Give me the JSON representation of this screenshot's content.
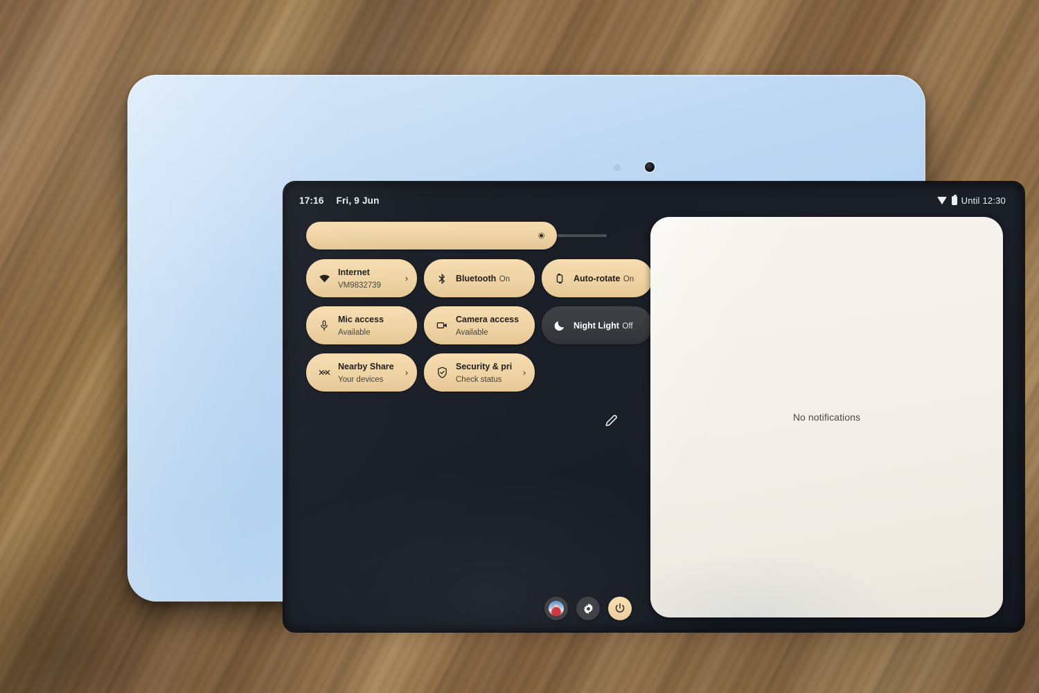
{
  "device": {
    "label": "tablet",
    "bezel_color": "#bcd7f2",
    "screen_bg": "#171b23"
  },
  "statusbar": {
    "time": "17:16",
    "date": "Fri, 9 Jun",
    "wifi_icon": "wifi-icon",
    "battery_icon": "battery-icon",
    "battery_text": "Until 12:30"
  },
  "quick_settings": {
    "brightness": {
      "label": "Brightness",
      "icon": "brightness-icon",
      "value_percent": 84
    },
    "tiles": [
      {
        "title": "Internet",
        "subtitle": "VM9832739",
        "icon": "wifi-icon",
        "state": "active",
        "has_chevron": true
      },
      {
        "title": "Bluetooth",
        "subtitle": "On",
        "icon": "bluetooth-icon",
        "state": "active",
        "has_chevron": false
      },
      {
        "title": "Auto-rotate",
        "subtitle": "On",
        "icon": "auto-rotate-icon",
        "state": "active",
        "has_chevron": false
      },
      {
        "title": "Mic access",
        "subtitle": "Available",
        "icon": "microphone-icon",
        "state": "active",
        "has_chevron": false
      },
      {
        "title": "Camera access",
        "subtitle": "Available",
        "icon": "camera-icon",
        "state": "active",
        "has_chevron": false
      },
      {
        "title": "Night Light",
        "subtitle": "Off",
        "icon": "moon-icon",
        "state": "inactive",
        "has_chevron": false
      },
      {
        "title": "Nearby Share",
        "subtitle": "Your devices",
        "icon": "nearby-share-icon",
        "state": "active",
        "has_chevron": true
      },
      {
        "title": "Security & pri",
        "subtitle": "Check status",
        "icon": "shield-check-icon",
        "state": "active",
        "has_chevron": true
      }
    ],
    "edit_icon": "pencil-edit-icon",
    "footer_buttons": [
      {
        "name": "user-avatar-button",
        "icon": "avatar-icon",
        "style": "dark"
      },
      {
        "name": "settings-button",
        "icon": "gear-icon",
        "style": "dark"
      },
      {
        "name": "power-button",
        "icon": "power-icon",
        "style": "accent"
      }
    ]
  },
  "notifications": {
    "empty_text": "No notifications"
  },
  "colors": {
    "tile_active": "#eed2a3",
    "tile_inactive": "#383a3e",
    "panel": "#f1efe7",
    "text_dark": "#1d1b16",
    "text_light": "#ffffff"
  }
}
